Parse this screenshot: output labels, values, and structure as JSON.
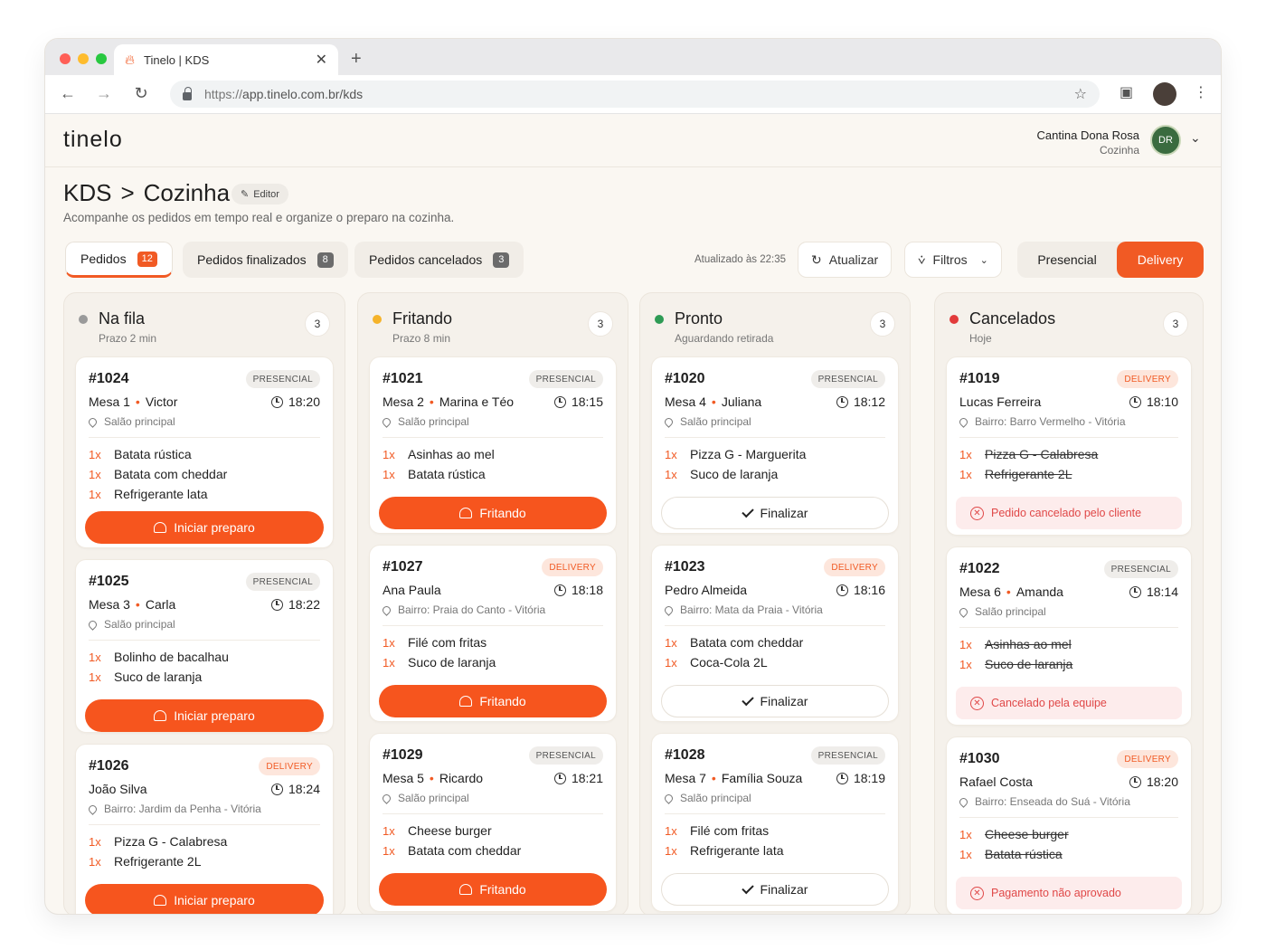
{
  "browser": {
    "tab_title": "Tinelo | KDS",
    "url_prefix": "https://",
    "url_rest": "app.tinelo.com.br/kds"
  },
  "app": {
    "logo": "tinelo",
    "restaurant": "Cantina Dona Rosa",
    "role": "Cozinha",
    "avatar_initials": "DR"
  },
  "page": {
    "crumb_root": "KDS",
    "crumb_sep": ">",
    "crumb_current": "Cozinha",
    "editor_label": "Editor",
    "subtitle": "Acompanhe os pedidos em tempo real e organize o preparo na cozinha."
  },
  "tabs": [
    {
      "label": "Pedidos",
      "count": "12"
    },
    {
      "label": "Pedidos finalizados",
      "count": "8"
    },
    {
      "label": "Pedidos cancelados",
      "count": "3"
    }
  ],
  "toolbar": {
    "updated": "Atualizado às 22:35",
    "refresh": "Atualizar",
    "filters": "Filtros",
    "mode_presencial": "Presencial",
    "mode_delivery": "Delivery"
  },
  "colors": {
    "accent": "#f15a24",
    "queue": "#9a9a9a",
    "frying": "#f5b32a",
    "ready": "#2e9b55",
    "canceled": "#e23b3b"
  },
  "columns": [
    {
      "title": "Na fila",
      "sub": "Prazo 2 min",
      "count": "3",
      "cards": [
        {
          "num": "#1024",
          "type": "PRESENCIAL",
          "cust": "Mesa 1",
          "name": "Victor",
          "time": "18:20",
          "loc": "Salão principal",
          "items": [
            {
              "q": "1x",
              "n": "Batata rústica"
            },
            {
              "q": "1x",
              "n": "Batata com cheddar"
            },
            {
              "q": "1x",
              "n": "Refrigerante lata"
            }
          ],
          "action": "Iniciar preparo"
        },
        {
          "num": "#1025",
          "type": "PRESENCIAL",
          "cust": "Mesa 3",
          "name": "Carla",
          "time": "18:22",
          "loc": "Salão principal",
          "items": [
            {
              "q": "1x",
              "n": "Bolinho de bacalhau"
            },
            {
              "q": "1x",
              "n": "Suco de laranja"
            }
          ],
          "action": "Iniciar preparo"
        },
        {
          "num": "#1026",
          "type": "DELIVERY",
          "cust": "João Silva",
          "time": "18:24",
          "loc": "Bairro: Jardim da Penha - Vitória",
          "items": [
            {
              "q": "1x",
              "n": "Pizza G - Calabresa"
            },
            {
              "q": "1x",
              "n": "Refrigerante 2L"
            }
          ],
          "action": "Iniciar preparo"
        }
      ]
    },
    {
      "title": "Fritando",
      "sub": "Prazo 8 min",
      "count": "3",
      "cards": [
        {
          "num": "#1021",
          "type": "PRESENCIAL",
          "cust": "Mesa 2",
          "name": "Marina e Téo",
          "time": "18:15",
          "loc": "Salão principal",
          "items": [
            {
              "q": "1x",
              "n": "Asinhas ao mel"
            },
            {
              "q": "1x",
              "n": "Batata rústica"
            }
          ],
          "action": "Fritando"
        },
        {
          "num": "#1027",
          "type": "DELIVERY",
          "cust": "Ana Paula",
          "time": "18:18",
          "loc": "Bairro: Praia do Canto - Vitória",
          "items": [
            {
              "q": "1x",
              "n": "Filé com fritas"
            },
            {
              "q": "1x",
              "n": "Suco de laranja"
            }
          ],
          "action": "Fritando"
        },
        {
          "num": "#1029",
          "type": "PRESENCIAL",
          "cust": "Mesa 5",
          "name": "Ricardo",
          "time": "18:21",
          "loc": "Salão principal",
          "items": [
            {
              "q": "1x",
              "n": "Cheese burger"
            },
            {
              "q": "1x",
              "n": "Batata com cheddar"
            }
          ],
          "action": "Fritando"
        }
      ]
    },
    {
      "title": "Pronto",
      "sub": "Aguardando retirada",
      "count": "3",
      "cards": [
        {
          "num": "#1020",
          "type": "PRESENCIAL",
          "cust": "Mesa 4",
          "name": "Juliana",
          "time": "18:12",
          "loc": "Salão principal",
          "items": [
            {
              "q": "1x",
              "n": "Pizza G - Marguerita"
            },
            {
              "q": "1x",
              "n": "Suco de laranja"
            }
          ],
          "action": "Finalizar"
        },
        {
          "num": "#1023",
          "type": "DELIVERY",
          "cust": "Pedro Almeida",
          "time": "18:16",
          "loc": "Bairro: Mata da Praia - Vitória",
          "items": [
            {
              "q": "1x",
              "n": "Batata com cheddar"
            },
            {
              "q": "1x",
              "n": "Coca-Cola 2L"
            }
          ],
          "action": "Finalizar"
        },
        {
          "num": "#1028",
          "type": "PRESENCIAL",
          "cust": "Mesa 7",
          "name": "Família Souza",
          "time": "18:19",
          "loc": "Salão principal",
          "items": [
            {
              "q": "1x",
              "n": "Filé com fritas"
            },
            {
              "q": "1x",
              "n": "Refrigerante lata"
            }
          ],
          "action": "Finalizar"
        }
      ]
    },
    {
      "title": "Cancelados",
      "sub": "Hoje",
      "count": "3",
      "cards": [
        {
          "num": "#1019",
          "type": "DELIVERY",
          "cust": "Lucas Ferreira",
          "time": "18:10",
          "loc": "Bairro: Barro Vermelho - Vitória",
          "items": [
            {
              "q": "1x",
              "n": "Pizza G - Calabresa"
            },
            {
              "q": "1x",
              "n": "Refrigerante 2L"
            }
          ],
          "reason": "Pedido cancelado pelo cliente"
        },
        {
          "num": "#1022",
          "type": "PRESENCIAL",
          "cust": "Mesa 6",
          "name": "Amanda",
          "time": "18:14",
          "loc": "Salão principal",
          "items": [
            {
              "q": "1x",
              "n": "Asinhas ao mel"
            },
            {
              "q": "1x",
              "n": "Suco de laranja"
            }
          ],
          "reason": "Cancelado pela equipe"
        },
        {
          "num": "#1030",
          "type": "DELIVERY",
          "cust": "Rafael Costa",
          "time": "18:20",
          "loc": "Bairro: Enseada do Suá - Vitória",
          "items": [
            {
              "q": "1x",
              "n": "Cheese burger"
            },
            {
              "q": "1x",
              "n": "Batata rústica"
            }
          ],
          "reason": "Pagamento não aprovado"
        }
      ]
    }
  ]
}
